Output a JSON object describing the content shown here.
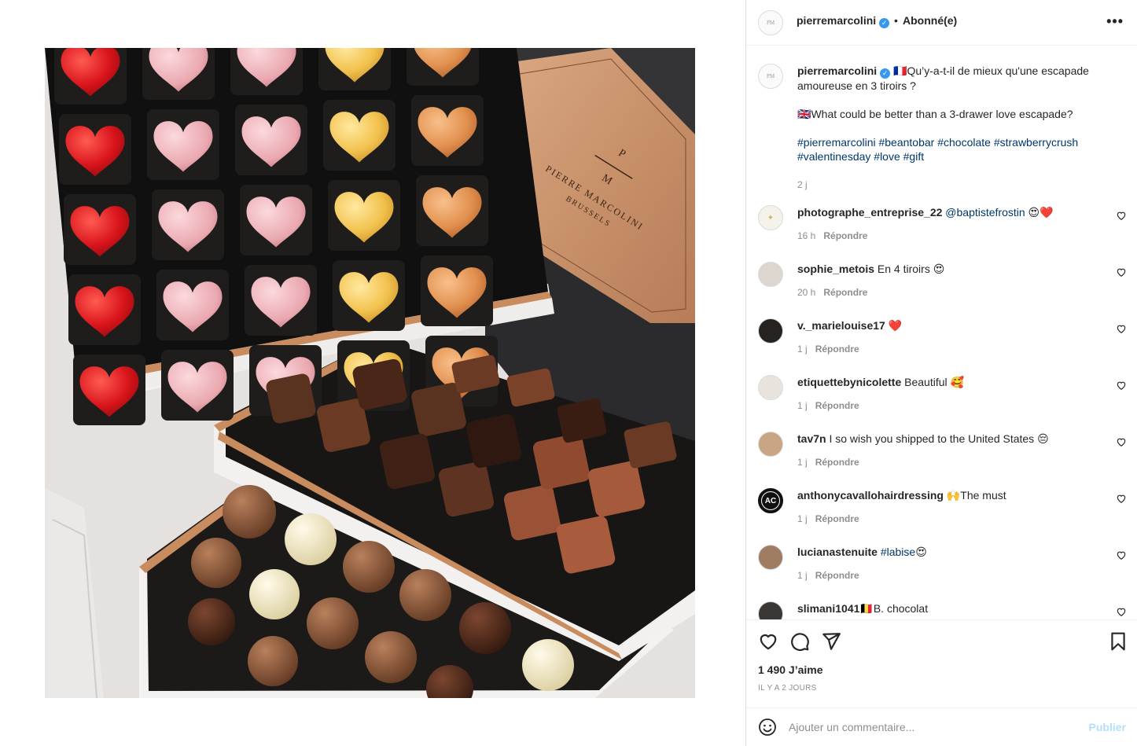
{
  "post": {
    "username": "pierremarcolini",
    "dot": "•",
    "follow_status": "Abonné(e)",
    "more": "•••"
  },
  "caption": {
    "username": "pierremarcolini",
    "fr_flag": "🇫🇷",
    "text_fr": "Qu’y-a-t-il de mieux qu'une escapade amoureuse en 3 tiroirs ?",
    "uk_flag": "🇬🇧",
    "text_en": "What could be better than a 3-drawer love escapade?",
    "hashtags": "#pierremarcolini #beantobar #chocolate #strawberrycrush #valentinesday #love #gift",
    "time": "2 j"
  },
  "comments": [
    {
      "username": "photographe_entreprise_22",
      "mention": "@baptistefrostin",
      "text": " 😍❤️",
      "time": "16 h",
      "reply": "Répondre"
    },
    {
      "username": "sophie_metois",
      "mention": "",
      "text": "En 4 tiroirs 😍",
      "time": "20 h",
      "reply": "Répondre"
    },
    {
      "username": "v._marielouise17",
      "mention": "",
      "text": "❤️",
      "time": "1 j",
      "reply": "Répondre"
    },
    {
      "username": "etiquettebynicolette",
      "mention": "",
      "text": "Beautiful 🥰",
      "time": "1 j",
      "reply": "Répondre"
    },
    {
      "username": "tav7n",
      "mention": "",
      "text": "I so wish you shipped to the United States 😔",
      "time": "1 j",
      "reply": "Répondre"
    },
    {
      "username": "anthonycavallohairdressing",
      "mention": "",
      "text": "🙌The must",
      "time": "1 j",
      "reply": "Répondre"
    },
    {
      "username": "lucianastenuite",
      "mention": "#labise",
      "text": "😍",
      "time": "1 j",
      "reply": "Répondre"
    },
    {
      "username": "slimani1041",
      "mention": "",
      "text": "🇧🇪B. chocolat",
      "time": "",
      "reply": ""
    }
  ],
  "avatars": {
    "ac_label": "AC"
  },
  "stats": {
    "likes": "1 490 J’aime",
    "date": "IL Y A 2 JOURS"
  },
  "composer": {
    "placeholder": "Ajouter un commentaire...",
    "publish": "Publier"
  },
  "icons": {
    "header_more": "more-horizontal-icon",
    "like": "heart-icon",
    "comment": "comment-icon",
    "share": "paper-plane-icon",
    "save": "bookmark-icon",
    "emoji": "smiley-icon",
    "comment_like": "small-heart-icon"
  },
  "photo": {
    "brand_mark_top": "P",
    "brand_mark_bottom": "M",
    "brand_name": "PIERRE MARCOLINI",
    "brand_city": "BRUSSELS"
  },
  "colors": {
    "link": "#00376b",
    "secondary": "#8e8e8e",
    "publish_disabled": "#b2dffc",
    "verified": "#3897f0"
  }
}
